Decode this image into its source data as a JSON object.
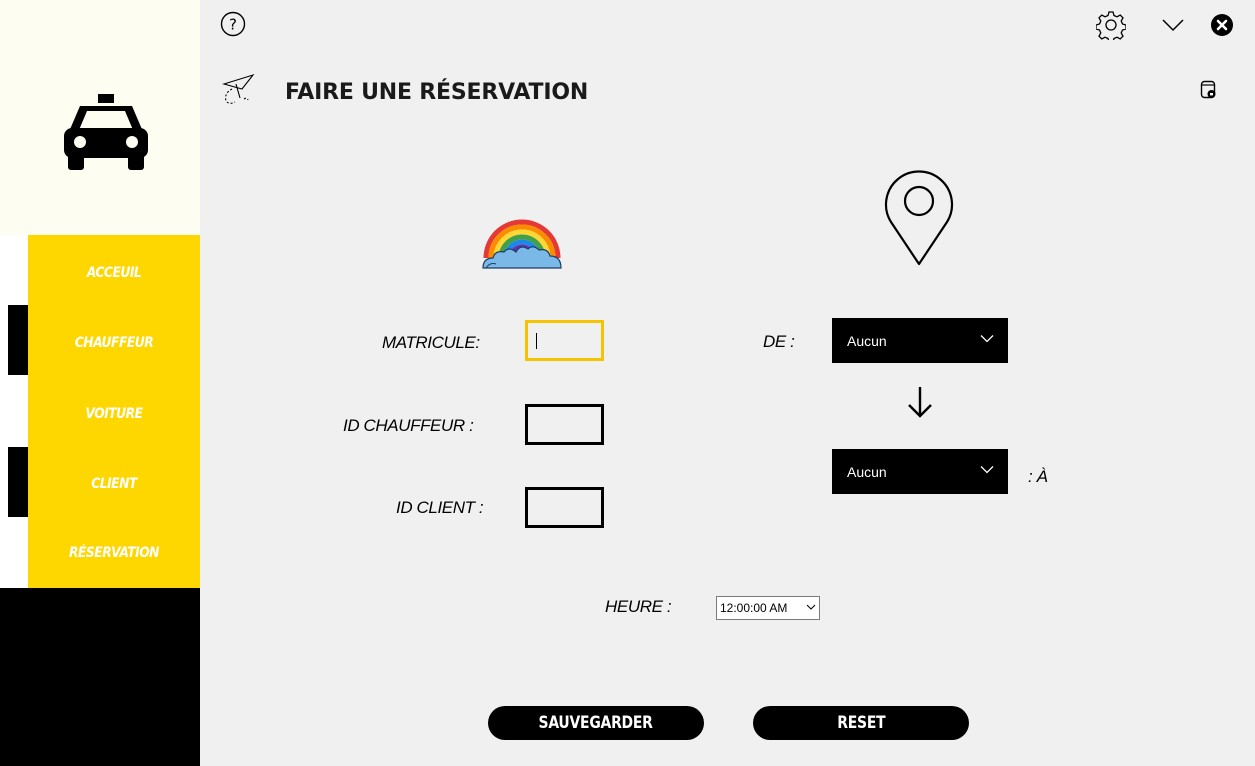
{
  "sidebar": {
    "items": [
      {
        "label": "ACCEUIL"
      },
      {
        "label": "CHAUFFEUR"
      },
      {
        "label": "VOITURE"
      },
      {
        "label": "CLIENT"
      },
      {
        "label": "RÉSERVATION"
      }
    ]
  },
  "header": {
    "title": "FAIRE UNE RÉSERVATION"
  },
  "form": {
    "matricule_label": "MATRICULE:",
    "matricule_value": "",
    "id_chauffeur_label": "ID CHAUFFEUR :",
    "id_chauffeur_value": "",
    "id_client_label": "ID CLIENT :",
    "id_client_value": "",
    "de_label": "DE :",
    "de_value": "Aucun",
    "a_label": ": À",
    "a_value": "Aucun",
    "heure_label": "HEURE :",
    "heure_value": "12:00:00 AM"
  },
  "buttons": {
    "save_label": "SAUVEGARDER",
    "reset_label": "RESET"
  },
  "colors": {
    "accent_yellow": "#ffd700",
    "focus_border": "#f5c400",
    "main_background": "#f0f0f0"
  },
  "icons": [
    "help-icon",
    "settings-icon",
    "minimize-icon",
    "close-icon",
    "taxi-icon",
    "paper-plane-icon",
    "database-icon",
    "rainbow-icon",
    "location-pin-icon",
    "arrow-down-icon"
  ]
}
